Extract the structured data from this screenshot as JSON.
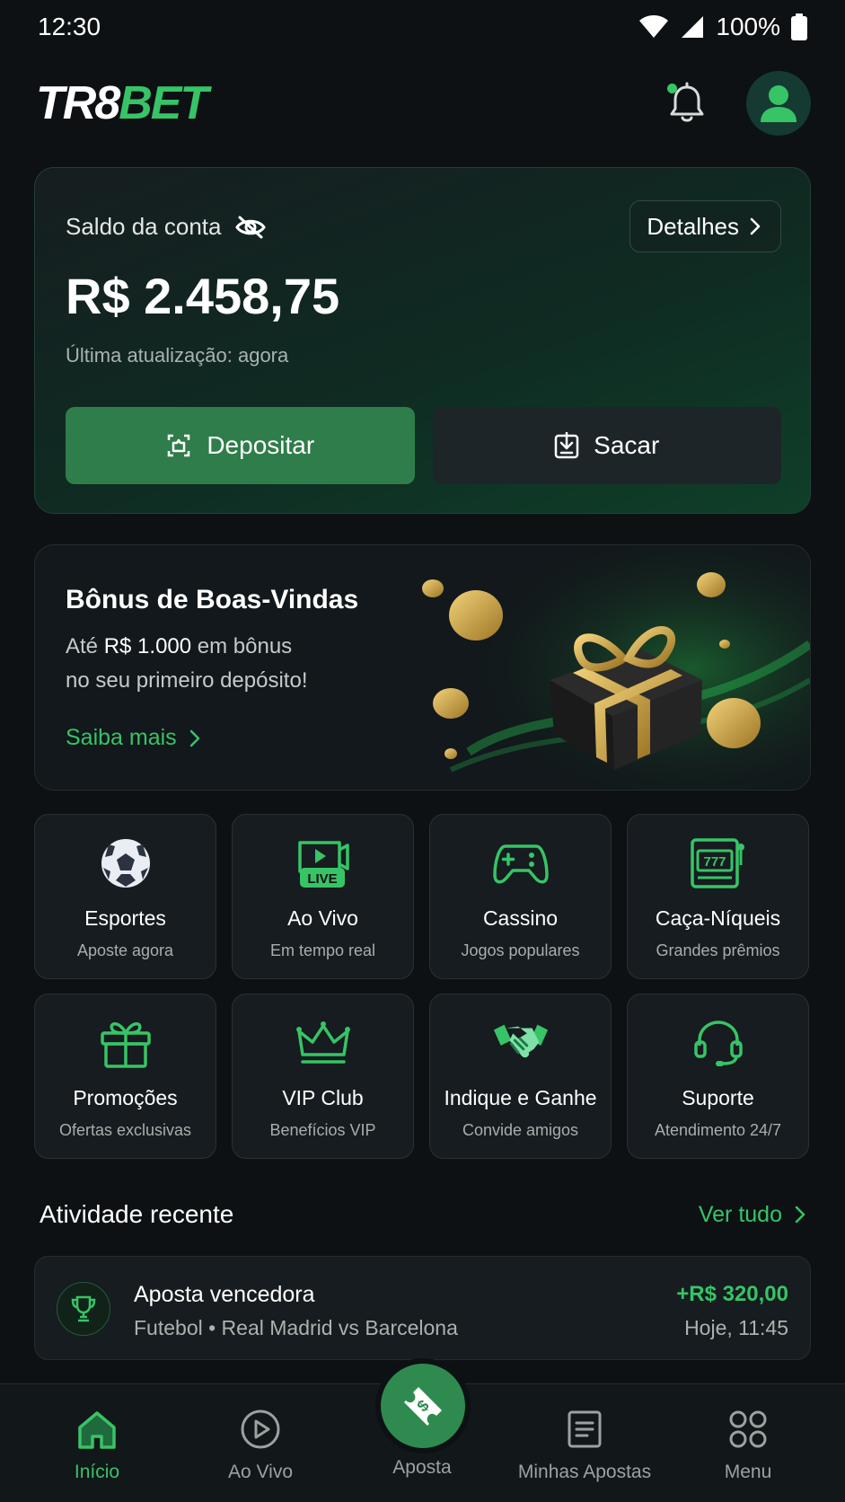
{
  "status_bar": {
    "time": "12:30",
    "battery": "100%"
  },
  "header": {
    "logo_part1": "TR8",
    "logo_part2": "BET",
    "icons": [
      "bell-icon",
      "avatar-icon"
    ],
    "accent_color": "#37c466"
  },
  "balance": {
    "label": "Saldo da conta",
    "details_label": "Detalhes",
    "amount": "R$ 2.458,75",
    "updated": "Última atualização: agora",
    "deposit_label": "Depositar",
    "withdraw_label": "Sacar"
  },
  "bonus": {
    "title": "Bônus de Boas-Vindas",
    "line1_prefix": "Até",
    "line1_value": "R$ 1.000",
    "line1_suffix": "em bônus",
    "line2": "no seu primeiro depósito!",
    "link": "Saiba mais"
  },
  "categories": [
    {
      "title": "Esportes",
      "subtitle": "Aposte agora",
      "icon": "soccer-ball-icon"
    },
    {
      "title": "Ao Vivo",
      "subtitle": "Em tempo real",
      "icon": "live-video-icon",
      "badge": "LIVE"
    },
    {
      "title": "Cassino",
      "subtitle": "Jogos populares",
      "icon": "gamepad-icon"
    },
    {
      "title": "Caça-Níqueis",
      "subtitle": "Grandes prêmios",
      "icon": "slot-machine-icon",
      "badge": "777"
    },
    {
      "title": "Promoções",
      "subtitle": "Ofertas exclusivas",
      "icon": "gift-icon"
    },
    {
      "title": "VIP Club",
      "subtitle": "Benefícios VIP",
      "icon": "crown-icon"
    },
    {
      "title": "Indique e Ganhe",
      "subtitle": "Convide amigos",
      "icon": "handshake-icon"
    },
    {
      "title": "Suporte",
      "subtitle": "Atendimento 24/7",
      "icon": "headset-icon"
    }
  ],
  "activity": {
    "title": "Atividade recente",
    "see_all": "Ver tudo",
    "items": [
      {
        "title": "Aposta vencedora",
        "subtitle": "Futebol • Real Madrid vs Barcelona",
        "amount": "+R$ 320,00",
        "time": "Hoje, 11:45",
        "icon": "trophy-icon"
      }
    ]
  },
  "bottom_nav": {
    "items": [
      {
        "label": "Início",
        "icon": "home-icon",
        "active": true
      },
      {
        "label": "Ao Vivo",
        "icon": "play-circle-icon"
      },
      {
        "label": "Aposta",
        "icon": "ticket-icon"
      },
      {
        "label": "Minhas Apostas",
        "icon": "list-icon"
      },
      {
        "label": "Menu",
        "icon": "grid-icon"
      }
    ]
  }
}
